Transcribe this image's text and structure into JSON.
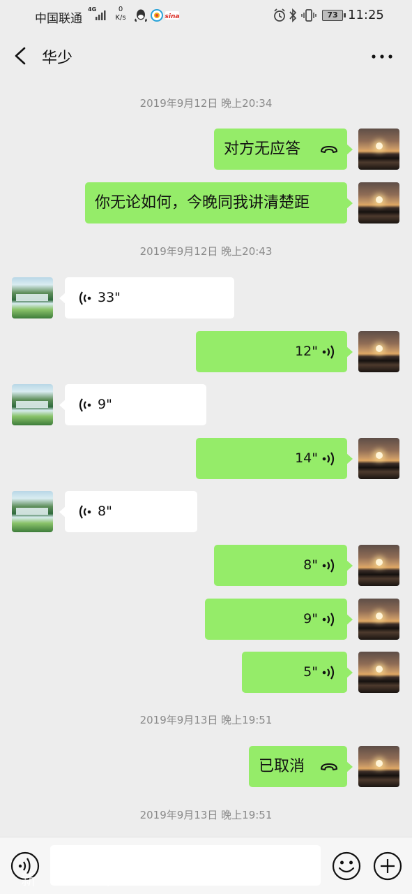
{
  "status_bar": {
    "carrier": "中国联通",
    "network": "4G",
    "speed_value": "0",
    "speed_unit": "K/s",
    "battery": "73",
    "time": "11:25",
    "icons": [
      "signal-icon",
      "qq-icon",
      "browser-icon",
      "weibo-icon",
      "alarm-icon",
      "bluetooth-icon",
      "vibrate-icon",
      "battery-icon"
    ]
  },
  "header": {
    "title": "华少",
    "back_icon": "chevron-left-icon",
    "more_icon": "more-dots-icon"
  },
  "colors": {
    "background": "#ededed",
    "outgoing_bubble": "#95ec69",
    "incoming_bubble": "#ffffff",
    "timestamp_text": "#8a8a8a"
  },
  "messages": {
    "ts_1": "2019年9月12日 晚上20:34",
    "call_1": "对方无应答",
    "text_1": "你无论如何，今晚同我讲清楚距",
    "ts_2": "2019年9月12日 晚上20:43",
    "voice_1": "33\"",
    "voice_2": "12\"",
    "voice_3": "9\"",
    "voice_4": "14\"",
    "voice_5": "8\"",
    "voice_6": "8\"",
    "voice_7": "9\"",
    "voice_8": "5\"",
    "ts_3": "2019年9月13日 晚上19:51",
    "call_2": "已取消",
    "ts_4": "2019年9月13日 晚上19:51"
  },
  "input_bar": {
    "value": "",
    "icons": [
      "voice-input-icon",
      "emoji-icon",
      "plus-icon"
    ]
  },
  "watermark": "新 三 维"
}
